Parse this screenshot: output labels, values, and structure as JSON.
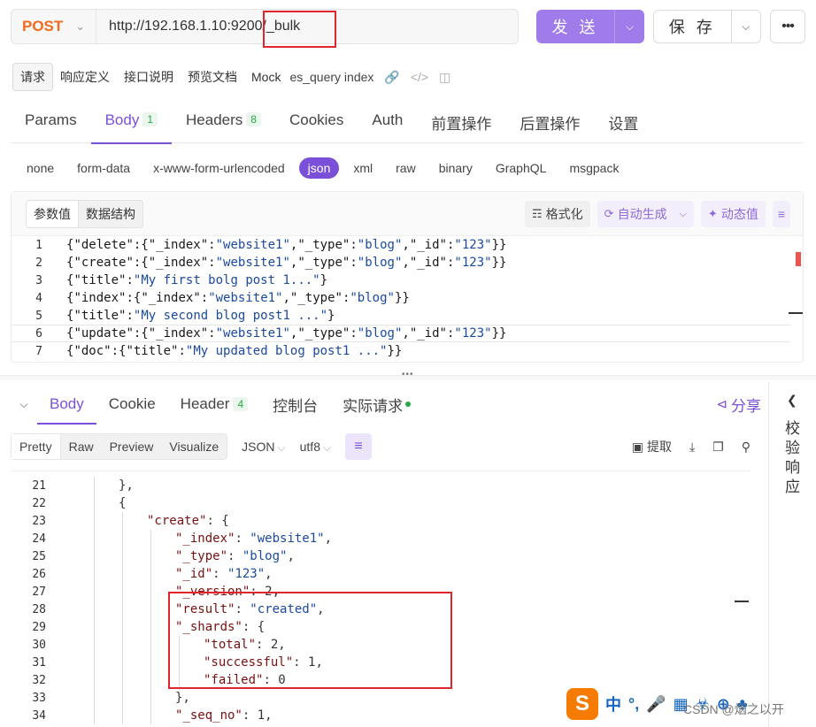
{
  "request": {
    "method": "POST",
    "url": "http://192.168.1.10:9200/_bulk",
    "send_label": "发 送",
    "save_label": "保 存"
  },
  "doc_tabs": [
    {
      "label": "请求"
    },
    {
      "label": "响应定义"
    },
    {
      "label": "接口说明"
    },
    {
      "label": "预览文档"
    },
    {
      "label": "Mock"
    }
  ],
  "doc_name": "es_query index",
  "req_tabs": [
    {
      "label": "Params",
      "badge": ""
    },
    {
      "label": "Body",
      "badge": "1"
    },
    {
      "label": "Headers",
      "badge": "8"
    },
    {
      "label": "Cookies",
      "badge": ""
    },
    {
      "label": "Auth",
      "badge": ""
    },
    {
      "label": "前置操作",
      "badge": ""
    },
    {
      "label": "后置操作",
      "badge": ""
    },
    {
      "label": "设置",
      "badge": ""
    }
  ],
  "body_types": [
    "none",
    "form-data",
    "x-www-form-urlencoded",
    "json",
    "xml",
    "raw",
    "binary",
    "GraphQL",
    "msgpack"
  ],
  "editor": {
    "seg_params": "参数值",
    "seg_schema": "数据结构",
    "format_label": "格式化",
    "autogen_label": "自动生成",
    "dynamic_label": "动态值",
    "lines": [
      "{\"delete\":{\"_index\":\"website1\",\"_type\":\"blog\",\"_id\":\"123\"}}",
      "{\"create\":{\"_index\":\"website1\",\"_type\":\"blog\",\"_id\":\"123\"}}",
      "{\"title\":\"My first bolg post 1...\"}",
      "{\"index\":{\"_index\":\"website1\",\"_type\":\"blog\"}}",
      "{\"title\":\"My second blog post1 ...\"}",
      "{\"update\":{\"_index\":\"website1\",\"_type\":\"blog\",\"_id\":\"123\"}}",
      "{\"doc\":{\"title\":\"My updated blog post1 ...\"}}"
    ]
  },
  "response": {
    "tabs": [
      {
        "label": "Body",
        "badge": ""
      },
      {
        "label": "Cookie",
        "badge": ""
      },
      {
        "label": "Header",
        "badge": "4"
      },
      {
        "label": "控制台",
        "badge": ""
      },
      {
        "label": "实际请求",
        "badge": ""
      }
    ],
    "share_label": "分享",
    "side_label": "校验响应",
    "formats": [
      "Pretty",
      "Raw",
      "Preview",
      "Visualize"
    ],
    "lang": "JSON",
    "encoding": "utf8",
    "extract_label": "提取",
    "body_lines": [
      {
        "n": "21",
        "indent": 2,
        "text": "},"
      },
      {
        "n": "22",
        "indent": 2,
        "text": "{"
      },
      {
        "n": "23",
        "indent": 3,
        "key": "create",
        "val": "{"
      },
      {
        "n": "24",
        "indent": 4,
        "key": "_index",
        "str": "website1",
        "tail": ","
      },
      {
        "n": "25",
        "indent": 4,
        "key": "_type",
        "str": "blog",
        "tail": ","
      },
      {
        "n": "26",
        "indent": 4,
        "key": "_id",
        "str": "123",
        "tail": ","
      },
      {
        "n": "27",
        "indent": 4,
        "key": "_version",
        "val": "2,"
      },
      {
        "n": "28",
        "indent": 4,
        "key": "result",
        "str": "created",
        "tail": ","
      },
      {
        "n": "29",
        "indent": 4,
        "key": "_shards",
        "val": "{"
      },
      {
        "n": "30",
        "indent": 5,
        "key": "total",
        "val": "2,"
      },
      {
        "n": "31",
        "indent": 5,
        "key": "successful",
        "val": "1,"
      },
      {
        "n": "32",
        "indent": 5,
        "key": "failed",
        "val": "0"
      },
      {
        "n": "33",
        "indent": 4,
        "text": "},"
      },
      {
        "n": "34",
        "indent": 4,
        "key": "_seq_no",
        "val": "1,"
      }
    ]
  },
  "ime": {
    "logo": "S",
    "chars": [
      "中",
      "°,",
      "🎤",
      "▦",
      "👕",
      "⊕",
      "♣"
    ]
  },
  "watermark": "CSDN @烟之以开"
}
